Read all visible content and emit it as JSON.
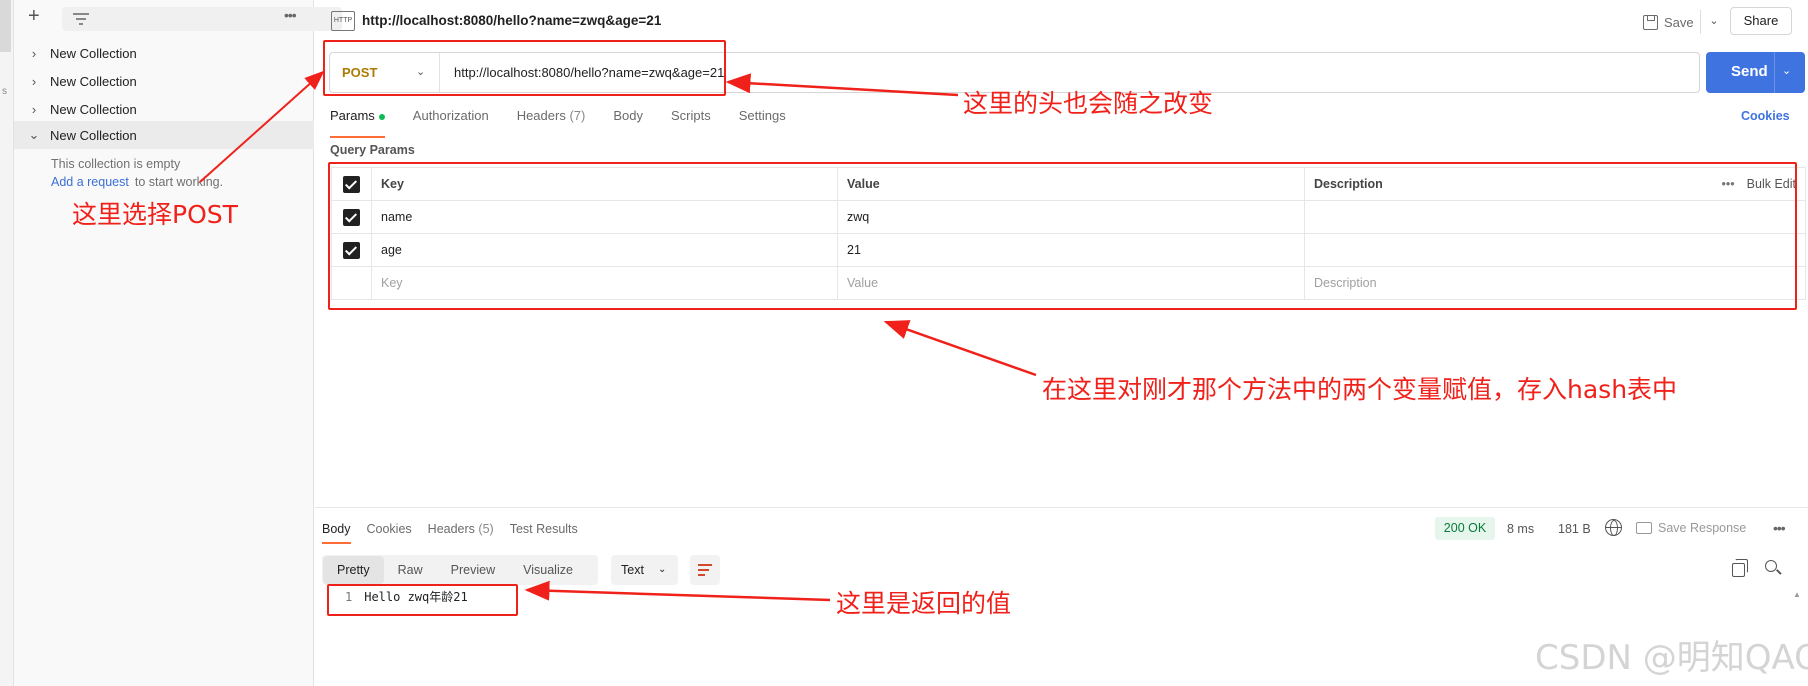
{
  "sidebar": {
    "collections": [
      {
        "label": "New Collection"
      },
      {
        "label": "New Collection"
      },
      {
        "label": "New Collection"
      },
      {
        "label": "New Collection"
      }
    ],
    "empty_text": "This collection is empty",
    "add_request_link": "Add a request",
    "add_request_suffix": "to start working."
  },
  "tab": {
    "badge": "HTTP",
    "title": "http://localhost:8080/hello?name=zwq&age=21",
    "save_label": "Save",
    "share_label": "Share"
  },
  "request": {
    "method": "POST",
    "url": "http://localhost:8080/hello?name=zwq&age=21",
    "send_label": "Send",
    "tabs": [
      {
        "label": "Params",
        "count": ""
      },
      {
        "label": "Authorization",
        "count": ""
      },
      {
        "label": "Headers",
        "count": "(7)"
      },
      {
        "label": "Body",
        "count": ""
      },
      {
        "label": "Scripts",
        "count": ""
      },
      {
        "label": "Settings",
        "count": ""
      }
    ],
    "cookies_label": "Cookies",
    "query_params_label": "Query Params",
    "table_headers": {
      "key": "Key",
      "value": "Value",
      "description": "Description",
      "bulk_edit": "Bulk Edit"
    },
    "params": [
      {
        "checked": true,
        "key": "name",
        "value": "zwq",
        "description": ""
      },
      {
        "checked": true,
        "key": "age",
        "value": "21",
        "description": ""
      }
    ],
    "placeholder_row": {
      "key": "Key",
      "value": "Value",
      "description": "Description"
    }
  },
  "response": {
    "tabs": [
      {
        "label": "Body",
        "count": ""
      },
      {
        "label": "Cookies",
        "count": ""
      },
      {
        "label": "Headers",
        "count": "(5)"
      },
      {
        "label": "Test Results",
        "count": ""
      }
    ],
    "status": "200 OK",
    "time": "8 ms",
    "size": "181 B",
    "save_response_label": "Save Response",
    "view_modes": [
      "Pretty",
      "Raw",
      "Preview",
      "Visualize"
    ],
    "format": "Text",
    "line_number": "1",
    "body": "Hello zwq年龄21"
  },
  "annotations": {
    "header_changes": "这里的头也会随之改变",
    "select_post": "这里选择POST",
    "assign_values": "在这里对刚才那个方法中的两个变量赋值，存入hash表中",
    "return_value": "这里是返回的值"
  },
  "watermark": "CSDN @明知QAQ",
  "colors": {
    "annotation_red": "#f0211a",
    "send_blue": "#3f73e0",
    "post_method": "#ad7a03",
    "active_tab_accent": "#ff6c37",
    "status_green": "#0a7a3a"
  }
}
